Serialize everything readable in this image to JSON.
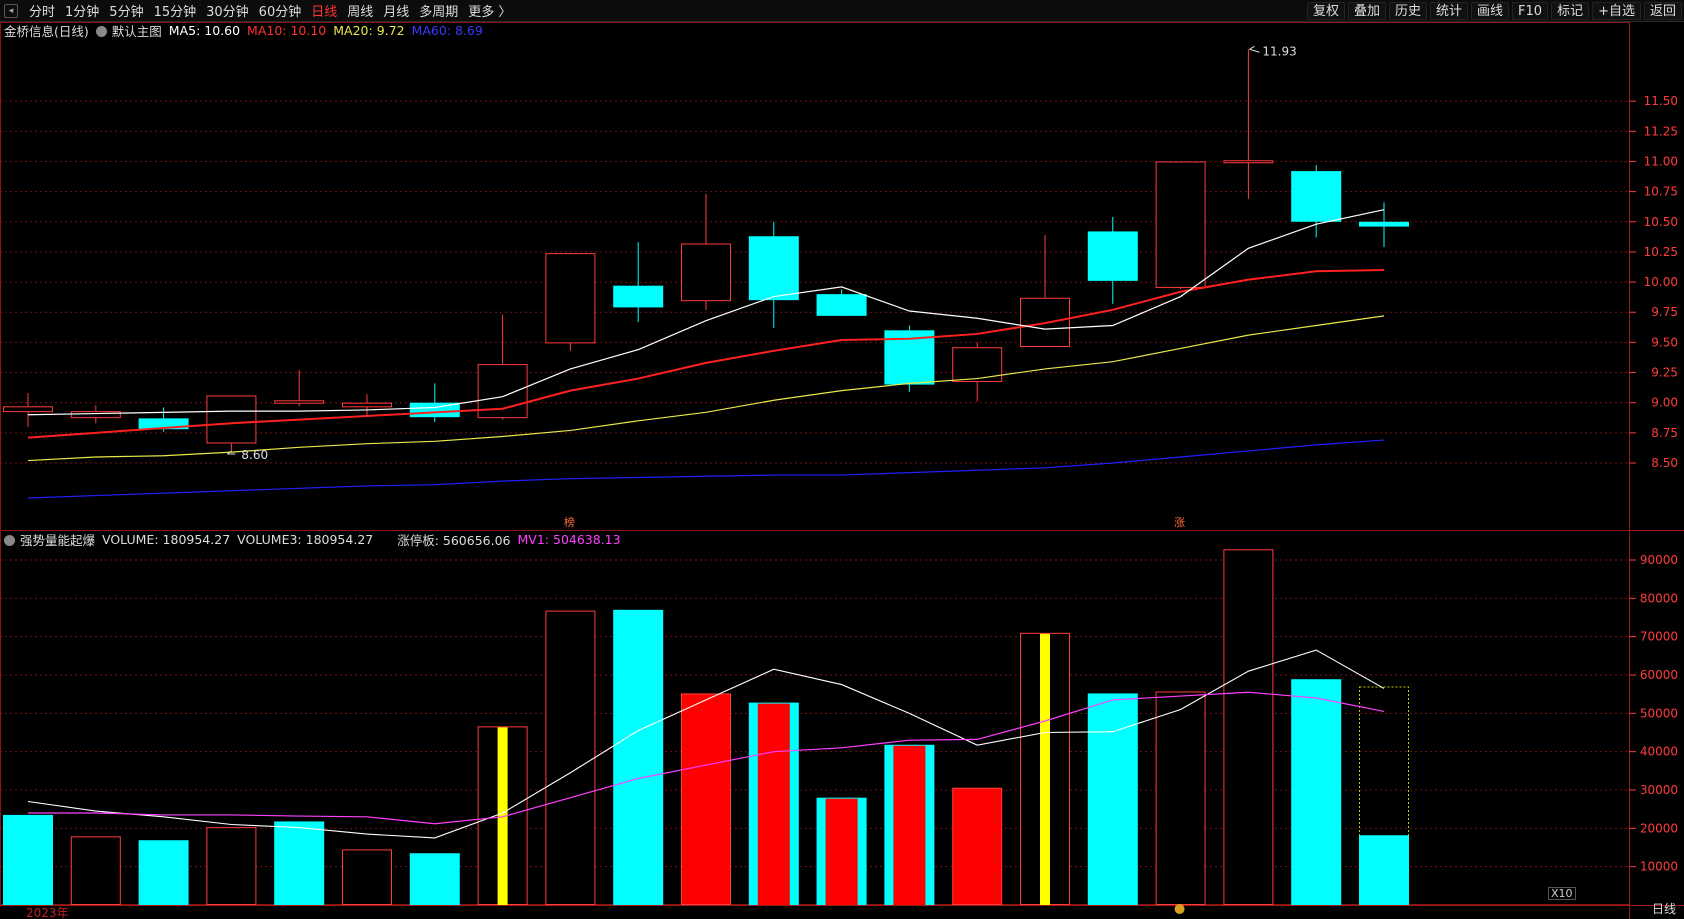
{
  "toolbar": {
    "periods": [
      "分时",
      "1分钟",
      "5分钟",
      "15分钟",
      "30分钟",
      "60分钟",
      "日线",
      "周线",
      "月线",
      "多周期",
      "更多 〉"
    ],
    "active_period": "日线",
    "right_buttons": [
      "复权",
      "叠加",
      "历史",
      "统计",
      "画线",
      "F10",
      "标记",
      "+自选",
      "返回"
    ]
  },
  "main_legend": {
    "title": "金桥信息(日线)",
    "indicator": "默认主图",
    "ma5": "MA5: 10.60",
    "ma10": "MA10: 10.10",
    "ma20": "MA20: 9.72",
    "ma60": "MA60: 8.69"
  },
  "vol_legend": {
    "title": "强势量能起爆",
    "volume": "VOLUME: 180954.27",
    "volume3": "VOLUME3: 180954.27",
    "limit": "涨停板: 560656.06",
    "mv1": "MV1: 504638.13"
  },
  "colors": {
    "up": "#ff3c3c",
    "down": "#00ffff",
    "ma5": "#ffffff",
    "ma10": "#ff2020",
    "ma20": "#e8e84a",
    "ma60": "#2020ff",
    "mv1": "#ff40ff",
    "grid": "#7a1010",
    "price_axis": "#ff3c3c"
  },
  "chart_data": [
    {
      "type": "candlestick",
      "ylim": [
        8.3,
        12.0
      ],
      "yticks": [
        "8.50",
        "8.75",
        "9.00",
        "9.25",
        "9.50",
        "9.75",
        "10.00",
        "10.25",
        "10.50",
        "10.75",
        "11.00",
        "11.25",
        "11.50"
      ],
      "candles": [
        {
          "open": 8.93,
          "high": 9.08,
          "low": 8.8,
          "close": 8.97
        },
        {
          "open": 8.88,
          "high": 8.98,
          "low": 8.83,
          "close": 8.93
        },
        {
          "open": 8.87,
          "high": 8.96,
          "low": 8.76,
          "close": 8.78
        },
        {
          "open": 8.67,
          "high": 9.06,
          "low": 8.6,
          "close": 9.06
        },
        {
          "open": 9.0,
          "high": 9.27,
          "low": 8.97,
          "close": 9.02
        },
        {
          "open": 8.97,
          "high": 9.07,
          "low": 8.89,
          "close": 9.0
        },
        {
          "open": 9.0,
          "high": 9.16,
          "low": 8.84,
          "close": 8.88
        },
        {
          "open": 8.88,
          "high": 9.73,
          "low": 8.86,
          "close": 9.32
        },
        {
          "open": 9.5,
          "high": 9.97,
          "low": 9.43,
          "close": 10.24
        },
        {
          "open": 9.97,
          "high": 10.33,
          "low": 9.67,
          "close": 9.79
        },
        {
          "open": 9.85,
          "high": 10.73,
          "low": 9.77,
          "close": 10.32
        },
        {
          "open": 10.38,
          "high": 10.5,
          "low": 9.62,
          "close": 9.85
        },
        {
          "open": 9.9,
          "high": 9.94,
          "low": 9.73,
          "close": 9.72
        },
        {
          "open": 9.6,
          "high": 9.64,
          "low": 9.09,
          "close": 9.15
        },
        {
          "open": 9.18,
          "high": 9.5,
          "low": 9.01,
          "close": 9.46
        },
        {
          "open": 9.47,
          "high": 10.39,
          "low": 9.47,
          "close": 9.87
        },
        {
          "open": 10.42,
          "high": 10.54,
          "low": 9.82,
          "close": 10.01
        },
        {
          "open": 9.96,
          "high": 10.99,
          "low": 9.94,
          "close": 11.0
        },
        {
          "open": 11.0,
          "high": 11.93,
          "low": 10.69,
          "close": 11.01
        },
        {
          "open": 10.92,
          "high": 10.97,
          "low": 10.37,
          "close": 10.5
        },
        {
          "open": 10.5,
          "high": 10.66,
          "low": 10.29,
          "close": 10.46
        }
      ],
      "ma5": [
        8.9,
        8.91,
        8.92,
        8.93,
        8.93,
        8.94,
        8.96,
        9.05,
        9.28,
        9.44,
        9.68,
        9.88,
        9.96,
        9.76,
        9.7,
        9.61,
        9.64,
        9.88,
        10.28,
        10.48,
        10.6
      ],
      "ma10": [
        8.71,
        8.75,
        8.79,
        8.83,
        8.86,
        8.89,
        8.92,
        8.95,
        9.1,
        9.2,
        9.33,
        9.43,
        9.52,
        9.53,
        9.57,
        9.66,
        9.77,
        9.92,
        10.02,
        10.09,
        10.1
      ],
      "ma20": [
        8.52,
        8.55,
        8.56,
        8.59,
        8.63,
        8.66,
        8.68,
        8.72,
        8.77,
        8.85,
        8.92,
        9.02,
        9.1,
        9.16,
        9.2,
        9.28,
        9.34,
        9.45,
        9.56,
        9.64,
        9.72
      ],
      "ma60": [
        8.21,
        8.23,
        8.25,
        8.27,
        8.29,
        8.31,
        8.32,
        8.35,
        8.37,
        8.38,
        8.39,
        8.4,
        8.4,
        8.42,
        8.44,
        8.46,
        8.5,
        8.55,
        8.6,
        8.65,
        8.69
      ],
      "annotations": {
        "high": "11.93",
        "low": "8.60",
        "marker_a": "榜",
        "marker_b": "涨"
      }
    },
    {
      "type": "bar",
      "ylim": [
        0,
        96000
      ],
      "yticks": [
        "10000",
        "20000",
        "30000",
        "40000",
        "50000",
        "60000",
        "70000",
        "80000",
        "90000"
      ],
      "volumes": [
        {
          "v": 23500,
          "style": "down"
        },
        {
          "v": 17900,
          "style": "up"
        },
        {
          "v": 16900,
          "style": "down"
        },
        {
          "v": 20300,
          "style": "up"
        },
        {
          "v": 21800,
          "style": "down"
        },
        {
          "v": 14500,
          "style": "up"
        },
        {
          "v": 13500,
          "style": "down"
        },
        {
          "v": 46600,
          "style": "up-yellow"
        },
        {
          "v": 76800,
          "style": "up"
        },
        {
          "v": 77000,
          "style": "down"
        },
        {
          "v": 55200,
          "style": "red-fill"
        },
        {
          "v": 52800,
          "style": "down-red"
        },
        {
          "v": 28000,
          "style": "down-red"
        },
        {
          "v": 41800,
          "style": "down-red"
        },
        {
          "v": 30600,
          "style": "red-fill"
        },
        {
          "v": 71000,
          "style": "up-yellow"
        },
        {
          "v": 55200,
          "style": "down"
        },
        {
          "v": 55700,
          "style": "up"
        },
        {
          "v": 92800,
          "style": "up"
        },
        {
          "v": 58900,
          "style": "down"
        },
        {
          "v": 18200,
          "style": "down-forecast"
        }
      ],
      "forecast_volume": 57000,
      "vol_ma_white": [
        27000,
        24500,
        23000,
        21000,
        20200,
        18500,
        17500,
        24000,
        34500,
        45500,
        53500,
        61500,
        57500,
        50000,
        41700,
        45000,
        45200,
        51000,
        61000,
        66500,
        56500
      ],
      "mv1": [
        24000,
        24000,
        23500,
        23500,
        23200,
        23000,
        21200,
        23000,
        28000,
        33000,
        36500,
        40000,
        41000,
        43000,
        43200,
        48000,
        53500,
        54500,
        55500,
        54000,
        50500
      ],
      "x_label": "2023年"
    }
  ],
  "bottom_right_label": "日线",
  "x10_label": "X10"
}
